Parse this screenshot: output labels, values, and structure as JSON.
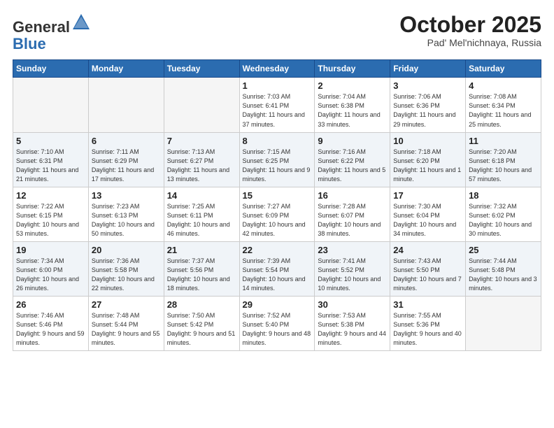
{
  "header": {
    "logo_general": "General",
    "logo_blue": "Blue",
    "month": "October 2025",
    "location": "Pad' Mel'nichnaya, Russia"
  },
  "days_of_week": [
    "Sunday",
    "Monday",
    "Tuesday",
    "Wednesday",
    "Thursday",
    "Friday",
    "Saturday"
  ],
  "weeks": [
    [
      {
        "day": "",
        "empty": true
      },
      {
        "day": "",
        "empty": true
      },
      {
        "day": "",
        "empty": true
      },
      {
        "day": "1",
        "sunrise": "7:03 AM",
        "sunset": "6:41 PM",
        "daylight": "11 hours and 37 minutes."
      },
      {
        "day": "2",
        "sunrise": "7:04 AM",
        "sunset": "6:38 PM",
        "daylight": "11 hours and 33 minutes."
      },
      {
        "day": "3",
        "sunrise": "7:06 AM",
        "sunset": "6:36 PM",
        "daylight": "11 hours and 29 minutes."
      },
      {
        "day": "4",
        "sunrise": "7:08 AM",
        "sunset": "6:34 PM",
        "daylight": "11 hours and 25 minutes."
      }
    ],
    [
      {
        "day": "5",
        "sunrise": "7:10 AM",
        "sunset": "6:31 PM",
        "daylight": "11 hours and 21 minutes."
      },
      {
        "day": "6",
        "sunrise": "7:11 AM",
        "sunset": "6:29 PM",
        "daylight": "11 hours and 17 minutes."
      },
      {
        "day": "7",
        "sunrise": "7:13 AM",
        "sunset": "6:27 PM",
        "daylight": "11 hours and 13 minutes."
      },
      {
        "day": "8",
        "sunrise": "7:15 AM",
        "sunset": "6:25 PM",
        "daylight": "11 hours and 9 minutes."
      },
      {
        "day": "9",
        "sunrise": "7:16 AM",
        "sunset": "6:22 PM",
        "daylight": "11 hours and 5 minutes."
      },
      {
        "day": "10",
        "sunrise": "7:18 AM",
        "sunset": "6:20 PM",
        "daylight": "11 hours and 1 minute."
      },
      {
        "day": "11",
        "sunrise": "7:20 AM",
        "sunset": "6:18 PM",
        "daylight": "10 hours and 57 minutes."
      }
    ],
    [
      {
        "day": "12",
        "sunrise": "7:22 AM",
        "sunset": "6:15 PM",
        "daylight": "10 hours and 53 minutes."
      },
      {
        "day": "13",
        "sunrise": "7:23 AM",
        "sunset": "6:13 PM",
        "daylight": "10 hours and 50 minutes."
      },
      {
        "day": "14",
        "sunrise": "7:25 AM",
        "sunset": "6:11 PM",
        "daylight": "10 hours and 46 minutes."
      },
      {
        "day": "15",
        "sunrise": "7:27 AM",
        "sunset": "6:09 PM",
        "daylight": "10 hours and 42 minutes."
      },
      {
        "day": "16",
        "sunrise": "7:28 AM",
        "sunset": "6:07 PM",
        "daylight": "10 hours and 38 minutes."
      },
      {
        "day": "17",
        "sunrise": "7:30 AM",
        "sunset": "6:04 PM",
        "daylight": "10 hours and 34 minutes."
      },
      {
        "day": "18",
        "sunrise": "7:32 AM",
        "sunset": "6:02 PM",
        "daylight": "10 hours and 30 minutes."
      }
    ],
    [
      {
        "day": "19",
        "sunrise": "7:34 AM",
        "sunset": "6:00 PM",
        "daylight": "10 hours and 26 minutes."
      },
      {
        "day": "20",
        "sunrise": "7:36 AM",
        "sunset": "5:58 PM",
        "daylight": "10 hours and 22 minutes."
      },
      {
        "day": "21",
        "sunrise": "7:37 AM",
        "sunset": "5:56 PM",
        "daylight": "10 hours and 18 minutes."
      },
      {
        "day": "22",
        "sunrise": "7:39 AM",
        "sunset": "5:54 PM",
        "daylight": "10 hours and 14 minutes."
      },
      {
        "day": "23",
        "sunrise": "7:41 AM",
        "sunset": "5:52 PM",
        "daylight": "10 hours and 10 minutes."
      },
      {
        "day": "24",
        "sunrise": "7:43 AM",
        "sunset": "5:50 PM",
        "daylight": "10 hours and 7 minutes."
      },
      {
        "day": "25",
        "sunrise": "7:44 AM",
        "sunset": "5:48 PM",
        "daylight": "10 hours and 3 minutes."
      }
    ],
    [
      {
        "day": "26",
        "sunrise": "7:46 AM",
        "sunset": "5:46 PM",
        "daylight": "9 hours and 59 minutes."
      },
      {
        "day": "27",
        "sunrise": "7:48 AM",
        "sunset": "5:44 PM",
        "daylight": "9 hours and 55 minutes."
      },
      {
        "day": "28",
        "sunrise": "7:50 AM",
        "sunset": "5:42 PM",
        "daylight": "9 hours and 51 minutes."
      },
      {
        "day": "29",
        "sunrise": "7:52 AM",
        "sunset": "5:40 PM",
        "daylight": "9 hours and 48 minutes."
      },
      {
        "day": "30",
        "sunrise": "7:53 AM",
        "sunset": "5:38 PM",
        "daylight": "9 hours and 44 minutes."
      },
      {
        "day": "31",
        "sunrise": "7:55 AM",
        "sunset": "5:36 PM",
        "daylight": "9 hours and 40 minutes."
      },
      {
        "day": "",
        "empty": true
      }
    ]
  ]
}
